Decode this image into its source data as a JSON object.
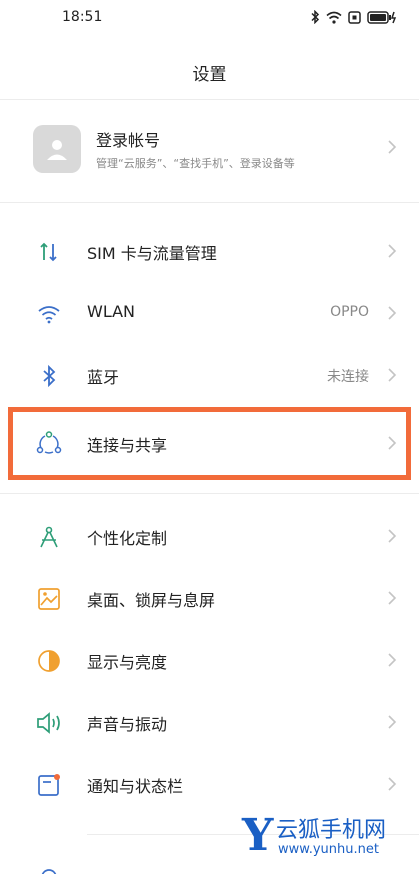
{
  "status_bar": {
    "time": "18:51",
    "icons": [
      "bluetooth-icon",
      "wifi-icon",
      "nfc-icon",
      "battery-charging-icon"
    ]
  },
  "header": {
    "title": "设置"
  },
  "account": {
    "title": "登录帐号",
    "subtitle": "管理“云服务”、“查找手机”、登录设备等"
  },
  "settings_group_1": [
    {
      "label": "SIM 卡与流量管理",
      "value": "",
      "icon": "sim-data-icon"
    },
    {
      "label": "WLAN",
      "value": "OPPO",
      "icon": "wlan-icon"
    },
    {
      "label": "蓝牙",
      "value": "未连接",
      "icon": "bluetooth-icon"
    },
    {
      "label": "连接与共享",
      "value": "",
      "icon": "connection-share-icon"
    }
  ],
  "settings_group_2": [
    {
      "label": "个性化定制",
      "value": "",
      "icon": "personalize-icon"
    },
    {
      "label": "桌面、锁屏与息屏",
      "value": "",
      "icon": "wallpaper-icon"
    },
    {
      "label": "显示与亮度",
      "value": "",
      "icon": "display-brightness-icon"
    },
    {
      "label": "声音与振动",
      "value": "",
      "icon": "sound-vibration-icon"
    },
    {
      "label": "通知与状态栏",
      "value": "",
      "icon": "notification-icon"
    }
  ],
  "colors": {
    "highlight": "#f26b3a",
    "accent_green": "#2e9e78",
    "accent_blue": "#3b6fc9",
    "accent_orange": "#f0a030",
    "watermark": "#1a5fc4"
  },
  "watermark": {
    "logo": "Y",
    "name": "云狐手机网",
    "url": "www.yunhu.net"
  }
}
